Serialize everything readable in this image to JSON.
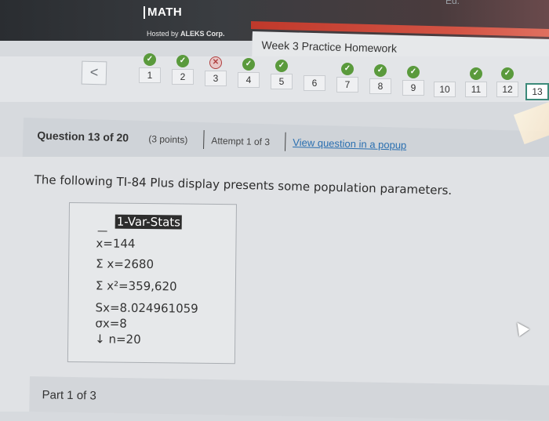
{
  "header": {
    "brand": "MATH",
    "hosted_prefix": "Hosted by",
    "hosted_by": "ALEKS Corp.",
    "corner_text": "Ed.",
    "assignment_title": "Week 3 Practice Homework"
  },
  "nav": {
    "back_label": "<",
    "questions": [
      {
        "label": "1",
        "status": "ok"
      },
      {
        "label": "2",
        "status": "ok"
      },
      {
        "label": "3",
        "status": "x"
      },
      {
        "label": "4",
        "status": "ok"
      },
      {
        "label": "5",
        "status": "ok"
      },
      {
        "label": "6",
        "status": "none"
      },
      {
        "label": "7",
        "status": "ok"
      },
      {
        "label": "8",
        "status": "ok"
      },
      {
        "label": "9",
        "status": "ok"
      },
      {
        "label": "10",
        "status": "none"
      },
      {
        "label": "11",
        "status": "ok"
      },
      {
        "label": "12",
        "status": "ok"
      },
      {
        "label": "13",
        "status": "current"
      }
    ]
  },
  "question": {
    "number_text": "Question 13 of 20",
    "points_text": "(3 points)",
    "attempt_text": "Attempt 1 of 3",
    "popup_link": "View question in a popup",
    "prompt": "The following TI-84 Plus display presents some population parameters."
  },
  "calculator": {
    "title": "1-Var-Stats",
    "lines": [
      "x=144",
      "Σ x=2680",
      "Σ x²=359,620",
      "Sx=8.024961059",
      "σx=8",
      "↓ n=20"
    ]
  },
  "part": {
    "label": "Part 1 of 3"
  },
  "icons": {
    "check": "check-circle-icon",
    "cross": "x-circle-icon",
    "back": "chevron-left-icon",
    "cursor": "mouse-cursor-icon"
  },
  "colors": {
    "check_green": "#5a9a3c",
    "link_blue": "#2a6fb0",
    "current_border": "#3c8a7a"
  }
}
